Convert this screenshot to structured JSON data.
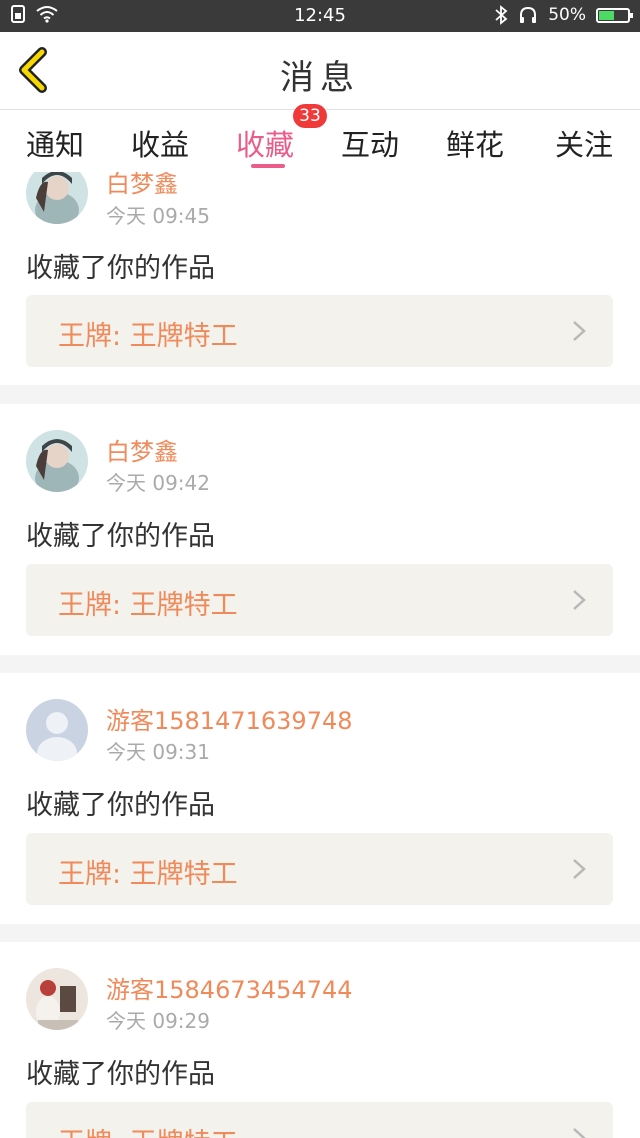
{
  "status_bar": {
    "time": "12:45",
    "battery": "50%",
    "battery_level": 0.5,
    "icons": [
      "sim-icon",
      "wifi-icon",
      "bluetooth-icon",
      "headset-icon",
      "battery-icon"
    ]
  },
  "header": {
    "title": "消息",
    "back_icon": "chevron-left-icon"
  },
  "tabs": [
    {
      "label": "通知"
    },
    {
      "label": "收益"
    },
    {
      "label": "收藏",
      "active": true,
      "badge": "33"
    },
    {
      "label": "互动"
    },
    {
      "label": "鲜花"
    },
    {
      "label": "关注"
    }
  ],
  "messages": [
    {
      "user": "白梦鑫",
      "time": "今天 09:45",
      "action": "收藏了你的作品",
      "work": "王牌: 王牌特工"
    },
    {
      "user": "白梦鑫",
      "time": "今天 09:42",
      "action": "收藏了你的作品",
      "work": "王牌: 王牌特工"
    },
    {
      "user": "游客1581471639748",
      "time": "今天 09:31",
      "action": "收藏了你的作品",
      "work": "王牌: 王牌特工"
    },
    {
      "user": "游客1584673454744",
      "time": "今天 09:29",
      "action": "收藏了你的作品",
      "work": "王牌: 王牌特工"
    }
  ],
  "colors": {
    "accent": "#ea5d8b",
    "badge": "#f03a3a",
    "username": "#f08a5a",
    "back_arrow": "#f5d900"
  }
}
